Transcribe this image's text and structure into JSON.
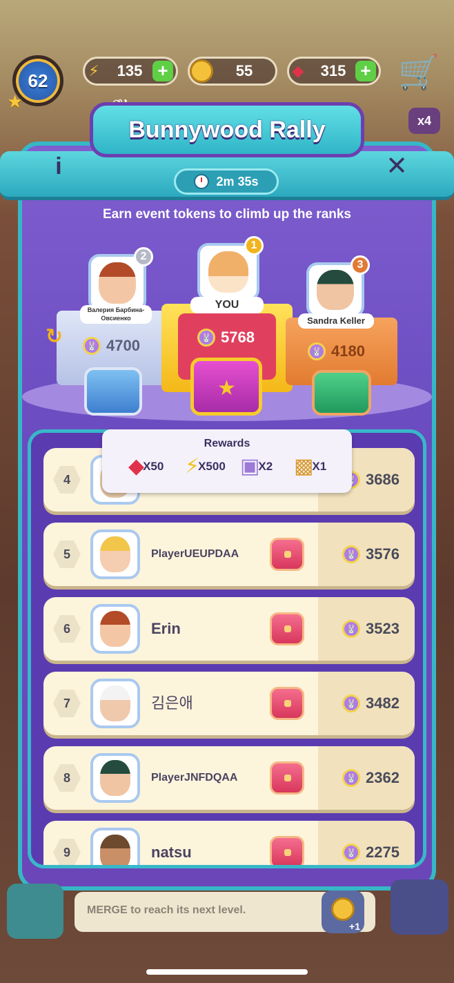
{
  "hud": {
    "level": "62",
    "energy": "135",
    "coins": "55",
    "gems": "315",
    "multiplier": "x4"
  },
  "event": {
    "title": "Bunnywood Rally",
    "timer": "2m 35s",
    "subtitle": "Earn event tokens to climb up the ranks",
    "info_label": "i",
    "close_label": "✕"
  },
  "podium": {
    "first": {
      "rank": "1",
      "name": "YOU",
      "score": "5768"
    },
    "second": {
      "rank": "2",
      "name": "Валерия Барбина-Овсиенко",
      "score": "4700"
    },
    "third": {
      "rank": "3",
      "name": "Sandra Keller",
      "score": "4180"
    }
  },
  "rewards": {
    "title": "Rewards",
    "items": [
      {
        "icon": "gem-icon",
        "qty": "X50"
      },
      {
        "icon": "energy-icon",
        "qty": "X500"
      },
      {
        "icon": "mystery-box-icon",
        "qty": "X2"
      },
      {
        "icon": "chest-icon",
        "qty": "X1"
      }
    ]
  },
  "leaderboard": [
    {
      "rank": "4",
      "name": "",
      "score": "3686"
    },
    {
      "rank": "5",
      "name": "PlayerUEUPDAA",
      "score": "3576"
    },
    {
      "rank": "6",
      "name": "Erin",
      "score": "3523"
    },
    {
      "rank": "7",
      "name": "김은애",
      "score": "3482"
    },
    {
      "rank": "8",
      "name": "PlayerJNFDQAA",
      "score": "2362"
    },
    {
      "rank": "9",
      "name": "natsu",
      "score": "2275"
    }
  ],
  "bottom": {
    "hint": "MERGE to reach its next level.",
    "coin_bonus": "+1"
  },
  "colors": {
    "panel": "#6a4cc0",
    "teal": "#36b7c6",
    "gold": "#f4b818",
    "row": "#fdf4dc"
  }
}
